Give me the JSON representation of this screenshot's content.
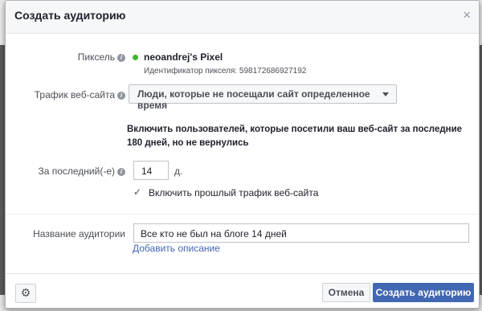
{
  "dialog": {
    "title": "Создать аудиторию",
    "close_glyph": "×"
  },
  "pixel": {
    "label": "Пиксель",
    "name": "neoandrej's Pixel",
    "id_text": "Идентификатор пикселя: 598172686927192",
    "status_color": "#42b72a"
  },
  "traffic": {
    "label": "Трафик веб-сайта",
    "selected": "Люди, которые не посещали сайт определенное время",
    "description": "Включить пользователей, которые посетили ваш веб-сайт за последние 180 дней, но не вернулись"
  },
  "period": {
    "label": "За последний(-е)",
    "value": "14",
    "unit": "д."
  },
  "past_traffic": {
    "checked": true,
    "label": "Включить прошлый трафик веб-сайта"
  },
  "audience": {
    "label": "Название аудитории",
    "value": "Все кто не был на блоге 14 дней",
    "add_description": "Добавить описание"
  },
  "footer": {
    "cancel_label": "Отмена",
    "create_label": "Создать аудиторию"
  },
  "colors": {
    "accent": "#4267b2"
  }
}
